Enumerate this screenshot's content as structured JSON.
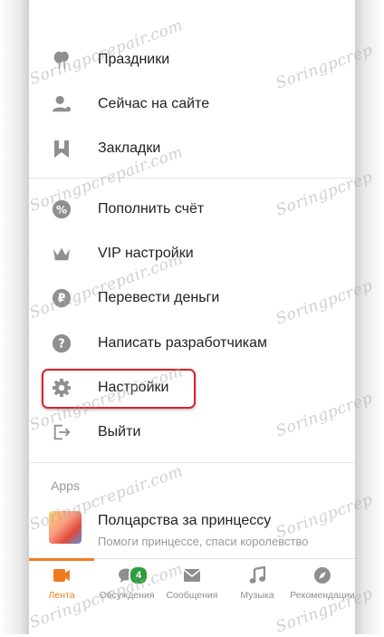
{
  "menu": {
    "items": [
      {
        "label": "Праздники",
        "icon": "balloons-icon"
      },
      {
        "label": "Сейчас на сайте",
        "icon": "users-online-icon"
      },
      {
        "label": "Закладки",
        "icon": "bookmark-icon"
      },
      {
        "label": "Пополнить счёт",
        "icon": "coin-plus-icon"
      },
      {
        "label": "VIP настройки",
        "icon": "crown-icon"
      },
      {
        "label": "Перевести деньги",
        "icon": "ruble-icon"
      },
      {
        "label": "Написать разработчикам",
        "icon": "help-icon"
      },
      {
        "label": "Настройки",
        "icon": "gear-icon"
      },
      {
        "label": "Выйти",
        "icon": "logout-icon"
      }
    ]
  },
  "apps": {
    "title": "Apps",
    "items": [
      {
        "title": "Полцарства за принцессу",
        "subtitle": "Помоги принцессе, спаси королевство"
      }
    ]
  },
  "tabbar": {
    "tabs": [
      {
        "label": "Лента",
        "icon": "feed-icon",
        "active": true
      },
      {
        "label": "Обсуждения",
        "icon": "discussions-icon",
        "badge": "4"
      },
      {
        "label": "Сообщения",
        "icon": "messages-icon"
      },
      {
        "label": "Музыка",
        "icon": "music-icon"
      },
      {
        "label": "Рекомендации",
        "icon": "compass-icon"
      }
    ]
  },
  "colors": {
    "accent": "#f07c1f",
    "highlight": "#d3262f",
    "badge": "#2e9e3c",
    "icon": "#8f8f8f"
  }
}
